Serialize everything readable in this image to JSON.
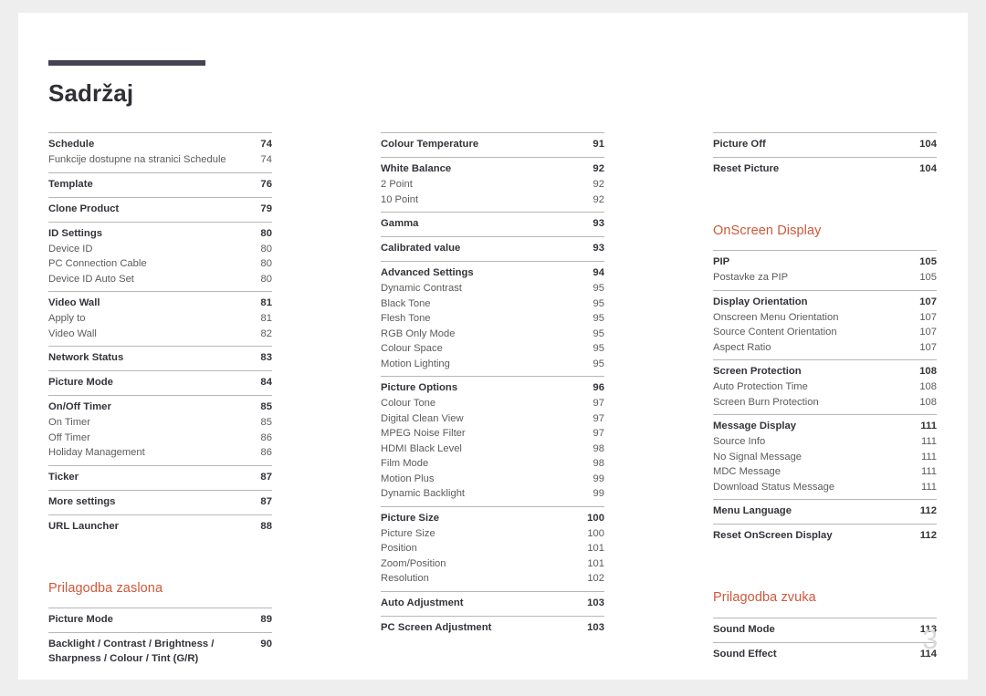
{
  "document": {
    "title": "Sadržaj",
    "folio": "3",
    "accent_color": "#454254",
    "section_color": "#d1573a"
  },
  "columns": [
    {
      "id": "column-1",
      "blocks": [
        {
          "type": "group",
          "rows": [
            {
              "level": "head",
              "label": "Schedule",
              "page": "74"
            },
            {
              "level": "sub",
              "label": "Funkcije dostupne na stranici Schedule",
              "page": "74"
            }
          ]
        },
        {
          "type": "group",
          "rows": [
            {
              "level": "head",
              "label": "Template",
              "page": "76"
            }
          ]
        },
        {
          "type": "group",
          "rows": [
            {
              "level": "head",
              "label": "Clone Product",
              "page": "79"
            }
          ]
        },
        {
          "type": "group",
          "rows": [
            {
              "level": "head",
              "label": "ID Settings",
              "page": "80"
            },
            {
              "level": "sub",
              "label": "Device ID",
              "page": "80"
            },
            {
              "level": "sub",
              "label": "PC Connection Cable",
              "page": "80"
            },
            {
              "level": "sub",
              "label": "Device ID Auto Set",
              "page": "80"
            }
          ]
        },
        {
          "type": "group",
          "rows": [
            {
              "level": "head",
              "label": "Video Wall",
              "page": "81"
            },
            {
              "level": "sub",
              "label": "Apply to",
              "page": "81"
            },
            {
              "level": "sub",
              "label": "Video Wall",
              "page": "82"
            }
          ]
        },
        {
          "type": "group",
          "rows": [
            {
              "level": "head",
              "label": "Network Status",
              "page": "83"
            }
          ]
        },
        {
          "type": "group",
          "rows": [
            {
              "level": "head",
              "label": "Picture Mode",
              "page": "84"
            }
          ]
        },
        {
          "type": "group",
          "rows": [
            {
              "level": "head",
              "label": "On/Off Timer",
              "page": "85"
            },
            {
              "level": "sub",
              "label": "On Timer",
              "page": "85"
            },
            {
              "level": "sub",
              "label": "Off Timer",
              "page": "86"
            },
            {
              "level": "sub",
              "label": "Holiday Management",
              "page": "86"
            }
          ]
        },
        {
          "type": "group",
          "rows": [
            {
              "level": "head",
              "label": "Ticker",
              "page": "87"
            }
          ]
        },
        {
          "type": "group",
          "rows": [
            {
              "level": "head",
              "label": "More settings",
              "page": "87"
            }
          ]
        },
        {
          "type": "group",
          "rows": [
            {
              "level": "head",
              "label": "URL Launcher",
              "page": "88"
            }
          ]
        },
        {
          "type": "spacer",
          "size": "lg"
        },
        {
          "type": "section",
          "label": "Prilagodba zaslona"
        },
        {
          "type": "group",
          "rows": [
            {
              "level": "head",
              "label": "Picture Mode",
              "page": "89"
            }
          ]
        },
        {
          "type": "group",
          "rows": [
            {
              "level": "head",
              "multiline": true,
              "label": "Backlight / Contrast / Brightness / Sharpness / Colour / Tint (G/R)",
              "page": "90"
            }
          ]
        }
      ]
    },
    {
      "id": "column-2",
      "blocks": [
        {
          "type": "group",
          "rows": [
            {
              "level": "head",
              "label": "Colour Temperature",
              "page": "91"
            }
          ]
        },
        {
          "type": "group",
          "rows": [
            {
              "level": "head",
              "label": "White Balance",
              "page": "92"
            },
            {
              "level": "sub",
              "label": "2 Point",
              "page": "92"
            },
            {
              "level": "sub",
              "label": "10 Point",
              "page": "92"
            }
          ]
        },
        {
          "type": "group",
          "rows": [
            {
              "level": "head",
              "label": "Gamma",
              "page": "93"
            }
          ]
        },
        {
          "type": "group",
          "rows": [
            {
              "level": "head",
              "label": "Calibrated value",
              "page": "93"
            }
          ]
        },
        {
          "type": "group",
          "rows": [
            {
              "level": "head",
              "label": "Advanced Settings",
              "page": "94"
            },
            {
              "level": "sub",
              "label": "Dynamic Contrast",
              "page": "95"
            },
            {
              "level": "sub",
              "label": "Black Tone",
              "page": "95"
            },
            {
              "level": "sub",
              "label": "Flesh Tone",
              "page": "95"
            },
            {
              "level": "sub",
              "label": "RGB Only Mode",
              "page": "95"
            },
            {
              "level": "sub",
              "label": "Colour Space",
              "page": "95"
            },
            {
              "level": "sub",
              "label": "Motion Lighting",
              "page": "95"
            }
          ]
        },
        {
          "type": "group",
          "rows": [
            {
              "level": "head",
              "label": "Picture Options",
              "page": "96"
            },
            {
              "level": "sub",
              "label": "Colour Tone",
              "page": "97"
            },
            {
              "level": "sub",
              "label": "Digital Clean View",
              "page": "97"
            },
            {
              "level": "sub",
              "label": "MPEG Noise Filter",
              "page": "97"
            },
            {
              "level": "sub",
              "label": "HDMI Black Level",
              "page": "98"
            },
            {
              "level": "sub",
              "label": "Film Mode",
              "page": "98"
            },
            {
              "level": "sub",
              "label": "Motion Plus",
              "page": "99"
            },
            {
              "level": "sub",
              "label": "Dynamic Backlight",
              "page": "99"
            }
          ]
        },
        {
          "type": "group",
          "rows": [
            {
              "level": "head",
              "label": "Picture Size",
              "page": "100"
            },
            {
              "level": "sub",
              "label": "Picture Size",
              "page": "100"
            },
            {
              "level": "sub",
              "label": "Position",
              "page": "101"
            },
            {
              "level": "sub",
              "label": "Zoom/Position",
              "page": "101"
            },
            {
              "level": "sub",
              "label": "Resolution",
              "page": "102"
            }
          ]
        },
        {
          "type": "group",
          "rows": [
            {
              "level": "head",
              "label": "Auto Adjustment",
              "page": "103"
            }
          ]
        },
        {
          "type": "group",
          "rows": [
            {
              "level": "head",
              "label": "PC Screen Adjustment",
              "page": "103"
            }
          ]
        }
      ]
    },
    {
      "id": "column-3",
      "blocks": [
        {
          "type": "group",
          "rows": [
            {
              "level": "head",
              "label": "Picture Off",
              "page": "104"
            }
          ]
        },
        {
          "type": "group",
          "rows": [
            {
              "level": "head",
              "label": "Reset Picture",
              "page": "104"
            }
          ]
        },
        {
          "type": "spacer",
          "size": "lg"
        },
        {
          "type": "section",
          "label": "OnScreen Display"
        },
        {
          "type": "group",
          "rows": [
            {
              "level": "head",
              "label": "PIP",
              "page": "105"
            },
            {
              "level": "sub",
              "label": "Postavke za PIP",
              "page": "105"
            }
          ]
        },
        {
          "type": "group",
          "rows": [
            {
              "level": "head",
              "label": "Display Orientation",
              "page": "107"
            },
            {
              "level": "sub",
              "label": "Onscreen Menu Orientation",
              "page": "107"
            },
            {
              "level": "sub",
              "label": "Source Content Orientation",
              "page": "107"
            },
            {
              "level": "sub",
              "label": "Aspect Ratio",
              "page": "107"
            }
          ]
        },
        {
          "type": "group",
          "rows": [
            {
              "level": "head",
              "label": "Screen Protection",
              "page": "108"
            },
            {
              "level": "sub",
              "label": "Auto Protection Time",
              "page": "108"
            },
            {
              "level": "sub",
              "label": "Screen Burn Protection",
              "page": "108"
            }
          ]
        },
        {
          "type": "group",
          "rows": [
            {
              "level": "head",
              "label": "Message Display",
              "page": "111"
            },
            {
              "level": "sub",
              "label": "Source Info",
              "page": "111"
            },
            {
              "level": "sub",
              "label": "No Signal Message",
              "page": "111"
            },
            {
              "level": "sub",
              "label": "MDC Message",
              "page": "111"
            },
            {
              "level": "sub",
              "label": "Download Status Message",
              "page": "111"
            }
          ]
        },
        {
          "type": "group",
          "rows": [
            {
              "level": "head",
              "label": "Menu Language",
              "page": "112"
            }
          ]
        },
        {
          "type": "group",
          "rows": [
            {
              "level": "head",
              "label": "Reset OnScreen Display",
              "page": "112"
            }
          ]
        },
        {
          "type": "spacer",
          "size": "lg"
        },
        {
          "type": "section",
          "label": "Prilagodba zvuka"
        },
        {
          "type": "group",
          "rows": [
            {
              "level": "head",
              "label": "Sound Mode",
              "page": "113"
            }
          ]
        },
        {
          "type": "group",
          "rows": [
            {
              "level": "head",
              "label": "Sound Effect",
              "page": "114"
            }
          ]
        }
      ]
    }
  ]
}
